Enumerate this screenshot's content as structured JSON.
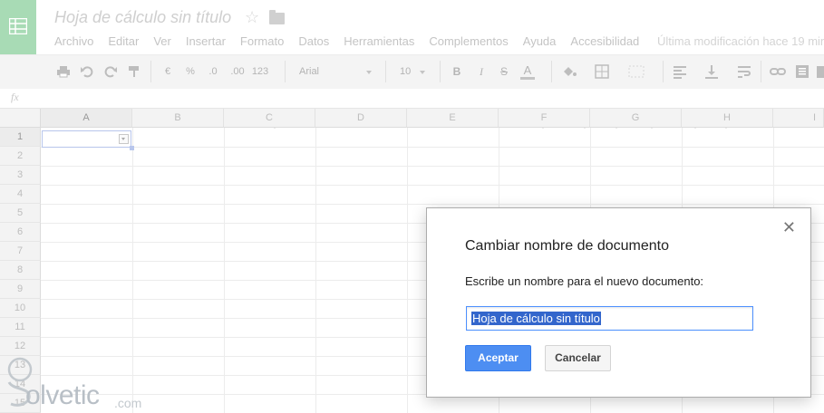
{
  "app": {
    "doc_title": "Hoja de cálculo sin título",
    "last_modified": "Última modificación hace 19 min"
  },
  "menu": [
    "Archivo",
    "Editar",
    "Ver",
    "Insertar",
    "Formato",
    "Datos",
    "Herramientas",
    "Complementos",
    "Ayuda",
    "Accesibilidad"
  ],
  "toolbar": {
    "currency": "€",
    "percent": "%",
    "dec_decrease": ".0",
    "dec_increase": ".00",
    "number_format": "123",
    "font": "Arial",
    "font_size": "10",
    "bold": "B",
    "italic": "I",
    "strike": "S",
    "text_color": "A"
  },
  "formula_bar": {
    "fx": "fx"
  },
  "grid": {
    "columns": [
      "A",
      "B",
      "C",
      "D",
      "E",
      "F",
      "G",
      "H",
      "I"
    ],
    "rows": [
      "1",
      "2",
      "3",
      "4",
      "5",
      "6",
      "7",
      "8",
      "9",
      "10",
      "11",
      "12",
      "13",
      "14",
      "15"
    ]
  },
  "dialog": {
    "title": "Cambiar nombre de documento",
    "prompt": "Escribe un nombre para el nuevo documento:",
    "input_value": "Hoja de cálculo sin título",
    "ok_label": "Aceptar",
    "cancel_label": "Cancelar",
    "close_glyph": "✕"
  },
  "watermark": {
    "text": "olvetic",
    "suffix": ".com"
  },
  "colors": {
    "accent": "#4d8ef2",
    "logo_green": "#a8dbb5",
    "selection": "#3366cc"
  }
}
